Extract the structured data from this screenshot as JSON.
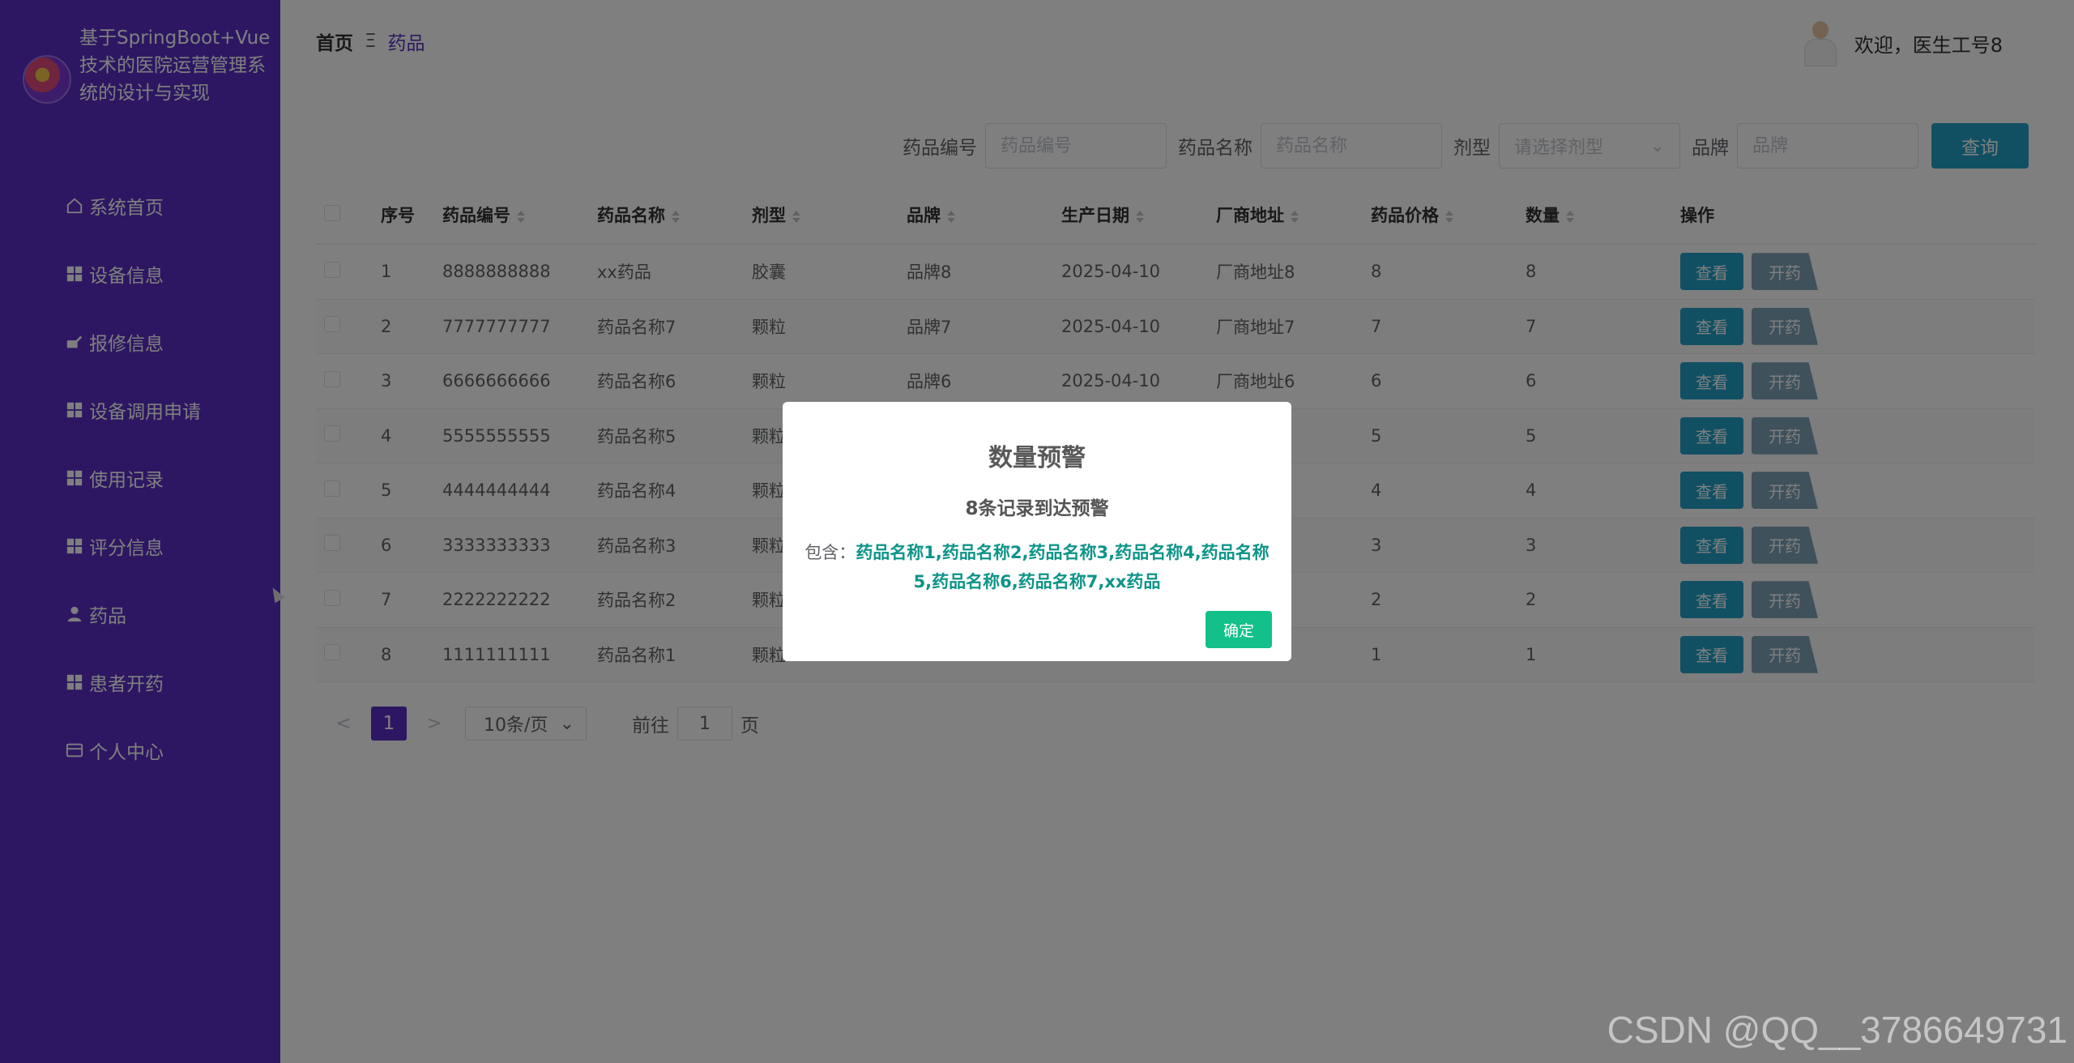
{
  "sidebar": {
    "title": "基于SpringBoot+Vue技术的医院运营管理系统的设计与实现",
    "items": [
      {
        "label": "系统首页",
        "icon": "home-icon"
      },
      {
        "label": "设备信息",
        "icon": "grid-icon"
      },
      {
        "label": "报修信息",
        "icon": "wrench-icon"
      },
      {
        "label": "设备调用申请",
        "icon": "grid-icon"
      },
      {
        "label": "使用记录",
        "icon": "grid-icon"
      },
      {
        "label": "评分信息",
        "icon": "grid-icon"
      },
      {
        "label": "药品",
        "icon": "user-icon"
      },
      {
        "label": "患者开药",
        "icon": "grid-icon"
      },
      {
        "label": "个人中心",
        "icon": "card-icon"
      }
    ]
  },
  "header": {
    "breadcrumb_home": "首页",
    "breadcrumb_sep": "Ξ",
    "breadcrumb_current": "药品",
    "welcome": "欢迎，医生工号8"
  },
  "search": {
    "code_label": "药品编号",
    "code_placeholder": "药品编号",
    "name_label": "药品名称",
    "name_placeholder": "药品名称",
    "form_label": "剂型",
    "form_placeholder": "请选择剂型",
    "brand_label": "品牌",
    "brand_placeholder": "品牌",
    "query_button": "查询"
  },
  "table": {
    "headers": {
      "index": "序号",
      "code": "药品编号",
      "name": "药品名称",
      "form": "剂型",
      "brand": "品牌",
      "date": "生产日期",
      "address": "厂商地址",
      "price": "药品价格",
      "qty": "数量",
      "ops": "操作"
    },
    "view_label": "查看",
    "prescribe_label": "开药",
    "rows": [
      {
        "index": "1",
        "code": "8888888888",
        "name": "xx药品",
        "form": "胶囊",
        "brand": "品牌8",
        "date": "2025-04-10",
        "address": "厂商地址8",
        "price": "8",
        "qty": "8"
      },
      {
        "index": "2",
        "code": "7777777777",
        "name": "药品名称7",
        "form": "颗粒",
        "brand": "品牌7",
        "date": "2025-04-10",
        "address": "厂商地址7",
        "price": "7",
        "qty": "7"
      },
      {
        "index": "3",
        "code": "6666666666",
        "name": "药品名称6",
        "form": "颗粒",
        "brand": "品牌6",
        "date": "2025-04-10",
        "address": "厂商地址6",
        "price": "6",
        "qty": "6"
      },
      {
        "index": "4",
        "code": "5555555555",
        "name": "药品名称5",
        "form": "颗粒",
        "brand": "",
        "date": "",
        "address": "",
        "price": "5",
        "qty": "5"
      },
      {
        "index": "5",
        "code": "4444444444",
        "name": "药品名称4",
        "form": "颗粒",
        "brand": "",
        "date": "",
        "address": "",
        "price": "4",
        "qty": "4"
      },
      {
        "index": "6",
        "code": "3333333333",
        "name": "药品名称3",
        "form": "颗粒",
        "brand": "",
        "date": "",
        "address": "",
        "price": "3",
        "qty": "3"
      },
      {
        "index": "7",
        "code": "2222222222",
        "name": "药品名称2",
        "form": "颗粒",
        "brand": "",
        "date": "",
        "address": "",
        "price": "2",
        "qty": "2"
      },
      {
        "index": "8",
        "code": "1111111111",
        "name": "药品名称1",
        "form": "颗粒",
        "brand": "",
        "date": "",
        "address": "",
        "price": "1",
        "qty": "1"
      }
    ]
  },
  "pagination": {
    "prev": "<",
    "current_page": "1",
    "next": ">",
    "page_size": "10条/页",
    "goto_prefix": "前往",
    "goto_value": "1",
    "goto_suffix": "页"
  },
  "modal": {
    "title": "数量预警",
    "subtitle": "8条记录到达预警",
    "contains_label": "包含：",
    "contains_list": "药品名称1,药品名称2,药品名称3,药品名称4,药品名称5,药品名称6,药品名称7,xx药品",
    "ok_button": "确定"
  },
  "watermark": "CSDN @QQ__3786649731",
  "colors": {
    "sidebar": "#5a2fc4",
    "primary_button": "#23a1c7",
    "secondary_button": "#7ea3b6",
    "ok_button": "#13c08a",
    "highlight_text": "#0d9488"
  }
}
